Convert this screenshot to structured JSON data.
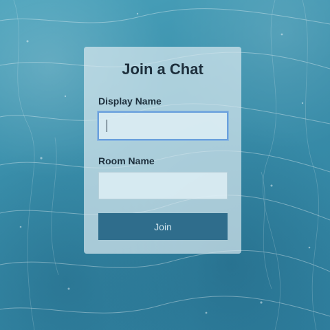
{
  "form": {
    "title": "Join a Chat",
    "display_name_label": "Display Name",
    "display_name_value": "",
    "room_name_label": "Room Name",
    "room_name_value": "",
    "join_label": "Join"
  },
  "colors": {
    "background": "#3f93ad",
    "card": "#d7e8ee",
    "button": "#2f6d8c",
    "focus_border": "#6aa0dc",
    "text": "#1d2f3c"
  }
}
